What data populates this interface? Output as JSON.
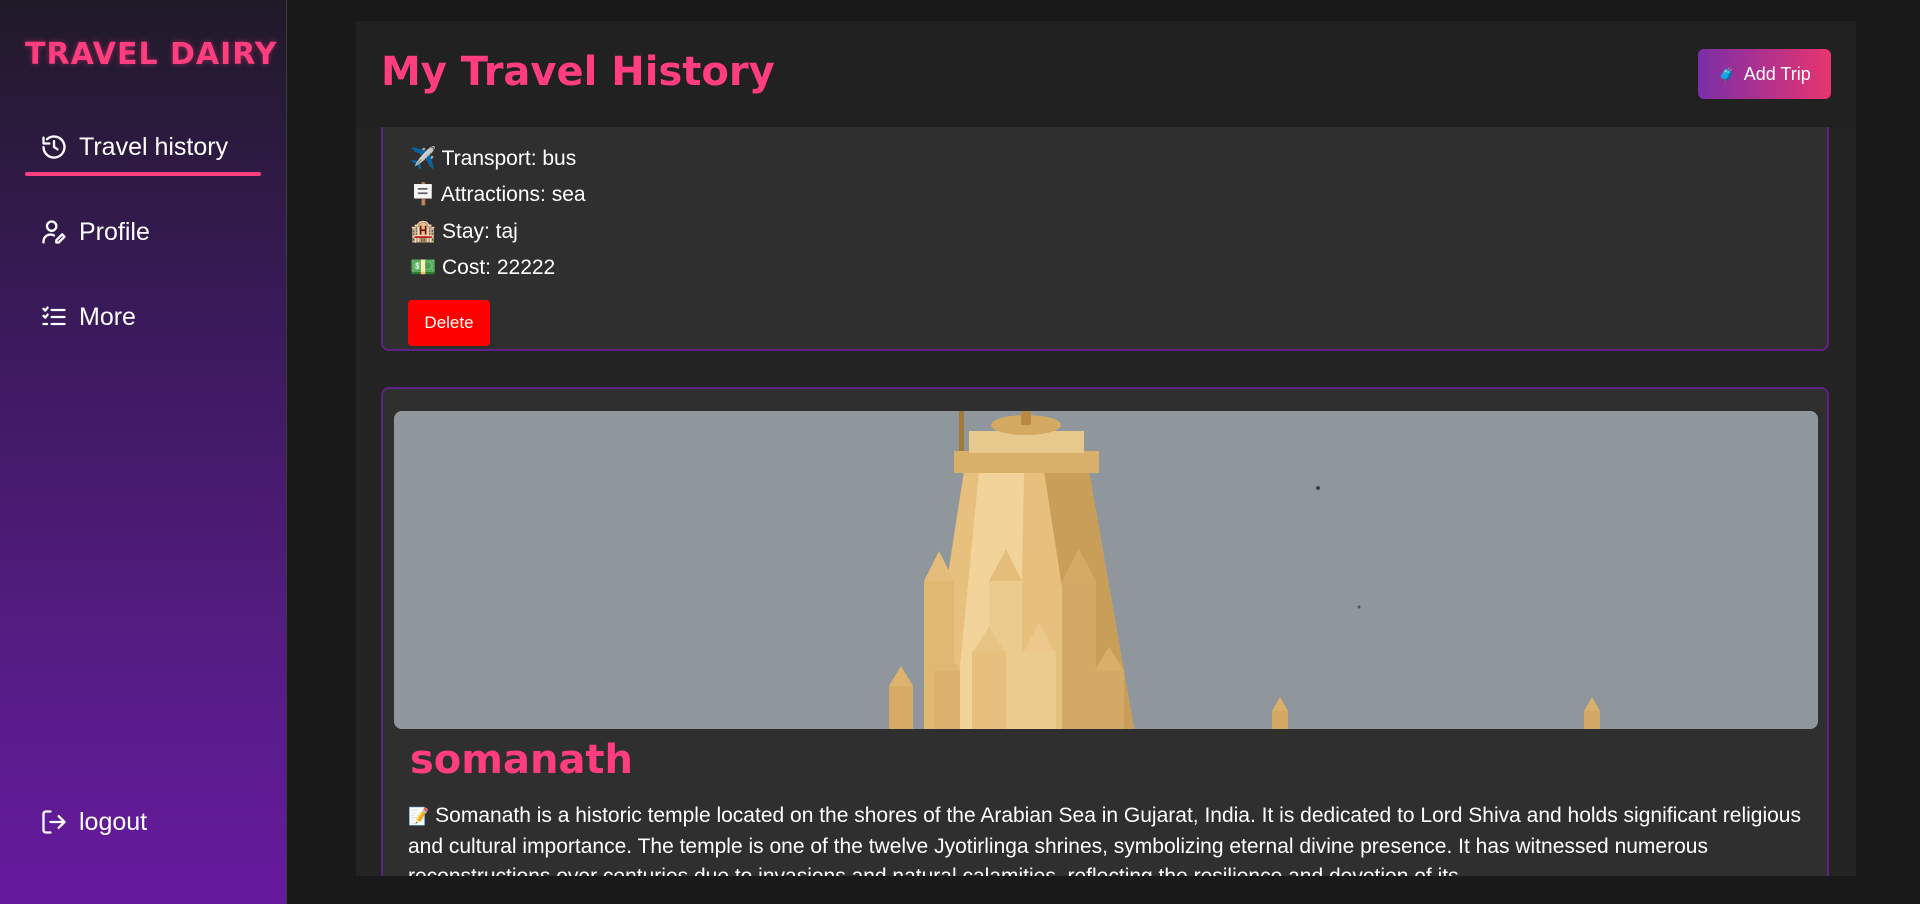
{
  "sidebar": {
    "brand": "TRAVEL DAIRY",
    "items": [
      {
        "label": "Travel history",
        "icon": "history-icon"
      },
      {
        "label": "Profile",
        "icon": "user-edit-icon"
      },
      {
        "label": "More",
        "icon": "list-icon"
      }
    ],
    "logout": {
      "label": "logout",
      "icon": "logout-icon"
    },
    "accent": "#ff3d7f"
  },
  "header": {
    "title": "My Travel History",
    "add_button": {
      "label": "Add Trip",
      "icon": "luggage-icon"
    }
  },
  "trips": [
    {
      "transport": "✈️ Transport: bus",
      "attractions": "🪧 Attractions: sea",
      "stay": "🏨 Stay: taj",
      "cost": "💵 Cost: 22222",
      "delete_label": "Delete"
    },
    {
      "title": "somanath",
      "description_icon": "📝",
      "description": "Somanath is a historic temple located on the shores of the Arabian Sea in Gujarat, India. It is dedicated to Lord Shiva and holds significant religious and cultural importance. The temple is one of the twelve Jyotirlinga shrines, symbolizing eternal divine presence. It has witnessed numerous reconstructions over centuries due to invasions and natural calamities, reflecting the resilience and devotion of its"
    }
  ]
}
